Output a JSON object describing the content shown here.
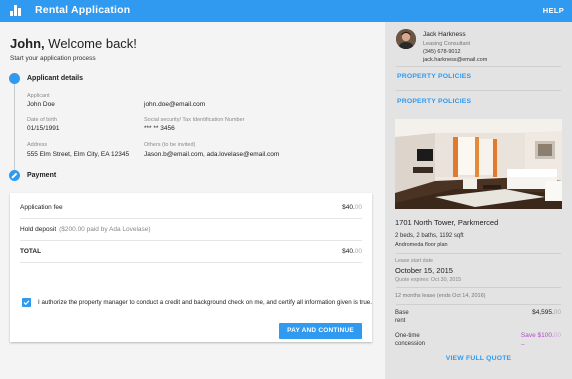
{
  "header": {
    "app_title": "Rental Application",
    "help_label": "HELP",
    "logo_icon": "bar-chart-icon",
    "accent_color": "#2f9af0"
  },
  "welcome": {
    "name": "John,",
    "message": "Welcome back!",
    "subtitle": "Start your application process"
  },
  "applicant": {
    "section_title": "Applicant details",
    "applicant_label": "Applicant",
    "applicant_value": "John Doe",
    "email_value": "john.doe@email.com",
    "dob_label": "Date of birth",
    "dob_value": "01/15/1991",
    "ssn_label": "Social security/ Tax Identification Number",
    "ssn_value": "*** ** 3456",
    "address_label": "Address",
    "address_value": "555 Elm Street, Elm City, EA 12345",
    "others_label": "Others (to be invited)",
    "others_value": "Jason.b@email.com, ada.lovelase@email.com"
  },
  "payment": {
    "section_title": "Payment",
    "rows": [
      {
        "label": "Application fee",
        "note": "",
        "amount": "$40.",
        "cents": "00"
      },
      {
        "label": "Hold deposit",
        "note": "($200.00 paid by Ada Lovelase)",
        "amount": "",
        "cents": ""
      },
      {
        "label": "TOTAL",
        "note": "",
        "amount": "$40.",
        "cents": "00"
      }
    ],
    "authorize_text": "I authorize the property manager to conduct a credit and background check on me, and certify all information given is true.",
    "authorize_checked": true,
    "pay_button": "PAY AND CONTINUE"
  },
  "agent": {
    "name": "Jack Harkness",
    "role": "Leasing Consultant",
    "phone": "(345) 678-9012",
    "email": "jack.harkness@email.com"
  },
  "sidebar": {
    "policies_link_1": "PROPERTY POLICIES",
    "policies_link_2": "PROPERTY POLICIES",
    "view_quote": "VIEW FULL QUOTE"
  },
  "property": {
    "address": "1701 North Tower, Parkmerced",
    "beds_baths": "2 beds, 2 baths, 1192 sqft",
    "floor_plan": "Andromeda floor plan",
    "lease_start_label": "Lease start date",
    "lease_start_date": "October 15, 2015",
    "quote_expires": "Quote expires: Oct 30, 2015",
    "lease_term": "12 months lease (ends Oct 14, 2016)"
  },
  "quote": {
    "base_label_1": "Base",
    "base_label_2": "rent",
    "base_amount": "$4,595.",
    "base_cents": "00",
    "concession_label_1": "One-time",
    "concession_label_2": "concession",
    "save_text": "Save  $100.",
    "save_cents": "00",
    "dash": "–"
  }
}
